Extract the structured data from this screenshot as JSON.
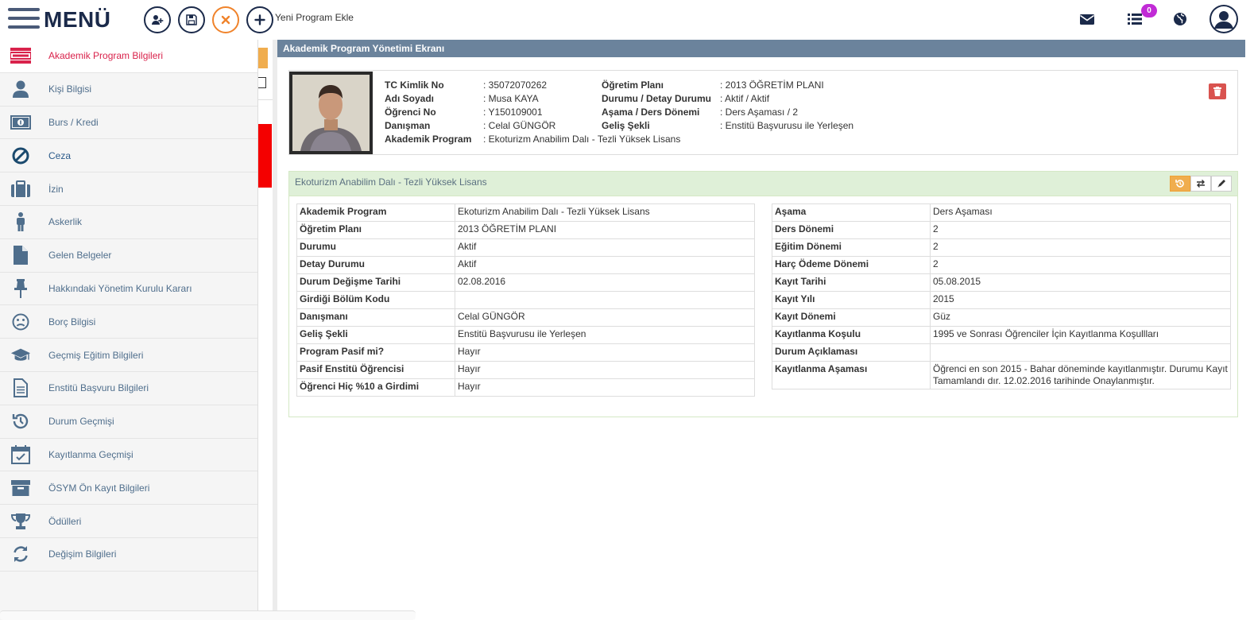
{
  "topbar": {
    "menu_label": "MENÜ",
    "new_program_label": "Yeni Program Ekle",
    "notification_count": "0",
    "icons": [
      "add-user-icon",
      "save-icon",
      "close-icon",
      "plus-icon",
      "mail-icon",
      "list-icon",
      "globe-icon",
      "user-avatar-icon"
    ],
    "colors": {
      "brand": "#1b2a4a",
      "cancel": "#f0832b",
      "badge": "#c12bd6"
    }
  },
  "sidebar": {
    "items": [
      {
        "label": "Akademik Program Bilgileri",
        "icon": "program-icon",
        "active": true
      },
      {
        "label": "Kişi Bilgisi",
        "icon": "person-icon"
      },
      {
        "label": "Burs / Kredi",
        "icon": "money-icon"
      },
      {
        "label": "Ceza",
        "icon": "ban-icon"
      },
      {
        "label": "İzin",
        "icon": "briefcase-icon"
      },
      {
        "label": "Askerlik",
        "icon": "male-icon"
      },
      {
        "label": "Gelen Belgeler",
        "icon": "file-icon"
      },
      {
        "label": "Hakkındaki Yönetim Kurulu Kararı",
        "icon": "pin-icon"
      },
      {
        "label": "Borç Bilgisi",
        "icon": "frown-icon"
      },
      {
        "label": "Geçmiş Eğitim Bilgileri",
        "icon": "graduation-cap-icon"
      },
      {
        "label": "Enstitü Başvuru Bilgileri",
        "icon": "document-icon"
      },
      {
        "label": "Durum Geçmişi",
        "icon": "history-icon"
      },
      {
        "label": "Kayıtlanma Geçmişi",
        "icon": "calendar-check-icon"
      },
      {
        "label": "ÖSYM Ön Kayıt Bilgileri",
        "icon": "archive-icon"
      },
      {
        "label": "Ödülleri",
        "icon": "trophy-icon"
      },
      {
        "label": "Değişim Bilgileri",
        "icon": "refresh-icon"
      }
    ],
    "active_color": "#d9224b",
    "label_color": "#4f6e8c"
  },
  "main": {
    "header": "Akademik Program Yönetimi Ekranı",
    "student": {
      "left": [
        {
          "label": "TC Kimlik No",
          "value": ": 35072070262"
        },
        {
          "label": "Adı Soyadı",
          "value": ": Musa KAYA"
        },
        {
          "label": "Öğrenci No",
          "value": ": Y150109001"
        },
        {
          "label": "Danışman",
          "value": ": Celal GÜNGÖR"
        },
        {
          "label": "Akademik Program",
          "value": ": Ekoturizm Anabilim Dalı - Tezli Yüksek Lisans"
        }
      ],
      "right": [
        {
          "label": "Öğretim Planı",
          "value": ": 2013 ÖĞRETİM PLANI"
        },
        {
          "label": "Durumu / Detay Durumu",
          "value": ": Aktif / Aktif"
        },
        {
          "label": "Aşama / Ders Dönemi",
          "value": ": Ders Aşaması / 2"
        },
        {
          "label": "Geliş Şekli",
          "value": ": Enstitü Başvurusu ile Yerleşen"
        }
      ]
    },
    "program": {
      "title": "Ekoturizm Anabilim Dalı - Tezli Yüksek Lisans",
      "left_table": [
        {
          "k": "Akademik Program",
          "v": "Ekoturizm Anabilim Dalı - Tezli Yüksek Lisans"
        },
        {
          "k": "Öğretim Planı",
          "v": "2013 ÖĞRETİM PLANI"
        },
        {
          "k": "Durumu",
          "v": "Aktif"
        },
        {
          "k": "Detay Durumu",
          "v": "Aktif"
        },
        {
          "k": "Durum Değişme Tarihi",
          "v": "02.08.2016"
        },
        {
          "k": "Girdiği Bölüm Kodu",
          "v": ""
        },
        {
          "k": "Danışmanı",
          "v": "Celal GÜNGÖR"
        },
        {
          "k": "Geliş Şekli",
          "v": "Enstitü Başvurusu ile Yerleşen"
        },
        {
          "k": "Program Pasif mi?",
          "v": "Hayır"
        },
        {
          "k": "Pasif Enstitü Öğrencisi",
          "v": "Hayır"
        },
        {
          "k": "Öğrenci Hiç %10 a Girdimi",
          "v": "Hayır"
        }
      ],
      "right_table": [
        {
          "k": "Aşama",
          "v": "Ders Aşaması"
        },
        {
          "k": "Ders Dönemi",
          "v": "2"
        },
        {
          "k": "Eğitim Dönemi",
          "v": "2"
        },
        {
          "k": "Harç Ödeme Dönemi",
          "v": "2"
        },
        {
          "k": "Kayıt Tarihi",
          "v": "05.08.2015"
        },
        {
          "k": "Kayıt Yılı",
          "v": "2015"
        },
        {
          "k": "Kayıt Dönemi",
          "v": "Güz"
        },
        {
          "k": "Kayıtlanma Koşulu",
          "v": "1995 ve Sonrası Öğrenciler İçin Kayıtlanma Koşullları"
        },
        {
          "k": "Durum Açıklaması",
          "v": ""
        },
        {
          "k": "Kayıtlanma Aşaması",
          "v": "Öğrenci en son 2015 - Bahar döneminde kayıtlanmıştır. Durumu Kayıt Tamamlandı dır. 12.02.2016 tarihinde Onaylanmıştır."
        }
      ]
    }
  }
}
